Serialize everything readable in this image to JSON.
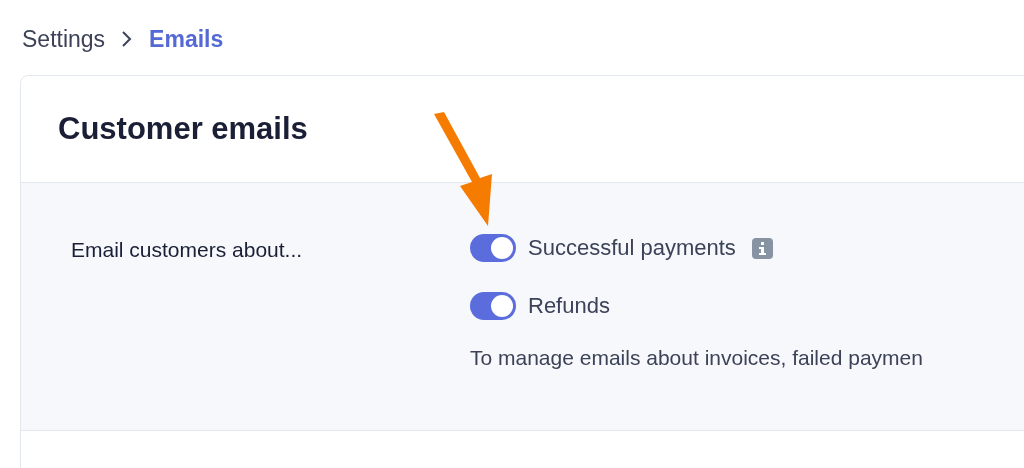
{
  "breadcrumb": [
    {
      "label": "Settings",
      "current": false
    },
    {
      "label": "Emails",
      "current": true
    }
  ],
  "card": {
    "title": "Customer emails",
    "setting": {
      "label": "Email customers about...",
      "toggles": [
        {
          "label": "Successful payments",
          "on": true,
          "info": true
        },
        {
          "label": "Refunds",
          "on": true,
          "info": false
        }
      ],
      "note": "To manage emails about invoices, failed paymen"
    }
  }
}
